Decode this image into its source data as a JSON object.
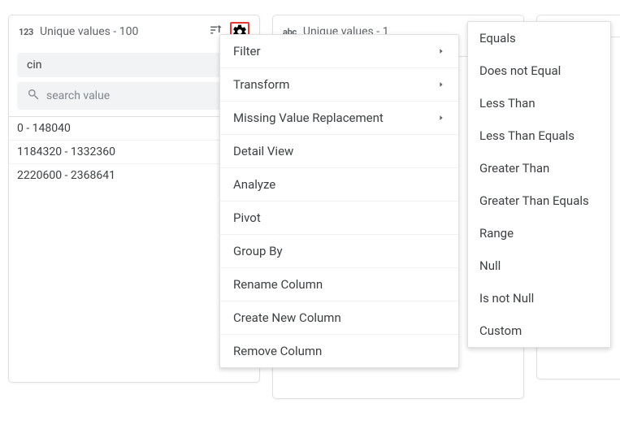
{
  "panels": {
    "p1": {
      "type_label": "123",
      "unique_label": "Unique values - 100",
      "name_input_value": "cin",
      "search_placeholder": "search value",
      "rows": [
        "0 - 148040",
        "1184320 - 1332360",
        "2220600 - 2368641"
      ]
    },
    "p2": {
      "type_label": "abc",
      "unique_label": "Unique values - 1"
    }
  },
  "context_menu": {
    "items": [
      {
        "label": "Filter",
        "submenu": true
      },
      {
        "label": "Transform",
        "submenu": true
      },
      {
        "label": "Missing Value Replacement",
        "submenu": true
      },
      {
        "label": "Detail View",
        "submenu": false
      },
      {
        "label": "Analyze",
        "submenu": false
      },
      {
        "label": "Pivot",
        "submenu": false
      },
      {
        "label": "Group By",
        "submenu": false
      },
      {
        "label": "Rename Column",
        "submenu": false
      },
      {
        "label": "Create New Column",
        "submenu": false
      },
      {
        "label": "Remove Column",
        "submenu": false
      }
    ]
  },
  "filter_submenu": [
    "Equals",
    "Does not Equal",
    "Less Than",
    "Less Than Equals",
    "Greater Than",
    "Greater Than Equals",
    "Range",
    "Null",
    "Is not Null",
    "Custom"
  ]
}
